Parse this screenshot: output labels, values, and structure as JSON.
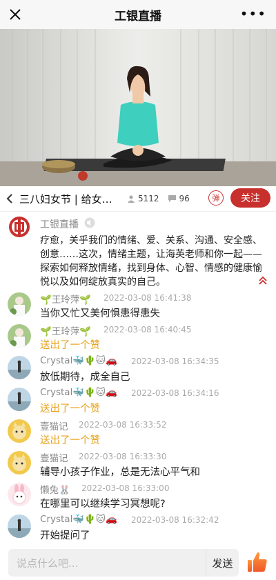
{
  "header": {
    "title": "工银直播",
    "close_icon": "close-icon",
    "more_label": "•••"
  },
  "stream": {
    "title": "三八妇女节 | 给女…",
    "viewers": "5112",
    "comments": "96",
    "danmu_label": "弹",
    "follow_label": "关注"
  },
  "host": {
    "name": "工银直播",
    "intro": "疗愈，关乎我们的情绪、爱、关系、沟通、安全感、创意……这次，情绪主题，让海英老师和你一起——探索如何释放情绪，找到身体、心智、情感的健康愉悦以及如何绽放真实的自己。"
  },
  "messages": [
    {
      "name": "🌱王玲萍🌱",
      "time": "2022-03-08 16:41:38",
      "text": "当你又忙又美何惧患得患失",
      "like": false
    },
    {
      "name": "🌱王玲萍🌱",
      "time": "2022-03-08 16:40:45",
      "text": "送出了一个赞",
      "like": true
    },
    {
      "name": "Crystal🐳🌵🐱🚗",
      "time": "2022-03-08 16:34:35",
      "text": "放低期待，成全自己",
      "like": false
    },
    {
      "name": "Crystal🐳🌵🐱🚗",
      "time": "2022-03-08 16:34:16",
      "text": "送出了一个赞",
      "like": true
    },
    {
      "name": "壹猫记",
      "time": "2022-03-08 16:33:52",
      "text": "送出了一个赞",
      "like": true
    },
    {
      "name": "壹猫记",
      "time": "2022-03-08 16:33:30",
      "text": "辅导小孩子作业，总是无法心平气和",
      "like": false
    },
    {
      "name": "懒兔🐰",
      "time": "2022-03-08 16:33:00",
      "text": "在哪里可以继续学习冥想呢?",
      "like": false
    },
    {
      "name": "Crystal🐳🌵🐱🚗",
      "time": "2022-03-08 16:32:42",
      "text": "开始提问了",
      "like": false
    }
  ],
  "composer": {
    "placeholder": "说点什么吧...",
    "send_label": "发送"
  },
  "colors": {
    "accent": "#c8302d",
    "like_text": "#e8a21a"
  }
}
